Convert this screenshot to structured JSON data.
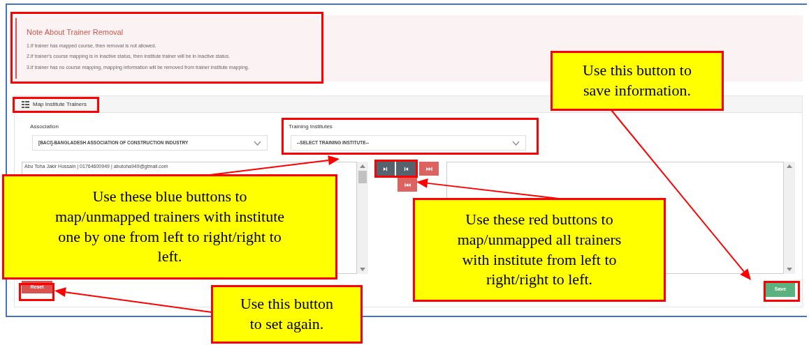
{
  "note": {
    "title": "Note About Trainer Removal",
    "lines": [
      "1.If trainer has mapped course, then removal is not allowed.",
      "2.If trainer's course mapping is in inactive status, then institute trainer will be in inactive status.",
      "3.If trainer has no course mapping, mapping information will be removed from trainer institute mapping."
    ]
  },
  "section": {
    "title": "Map Institute Trainers"
  },
  "fields": [
    {
      "label": "Association",
      "value": "[BACI]-BANGLADESH ASSOCIATION OF CONSTRUCTION INDUSTRY"
    },
    {
      "label": "Training Institutes",
      "value": "--SELECT TRAINING INSTITUTE--"
    }
  ],
  "left_list": [
    "Abu Toha Jakir Hossain | 01764600949 | abutoha949@gtmail.com"
  ],
  "transfer_buttons": [
    {
      "kind": "next"
    },
    {
      "kind": "previous"
    },
    {
      "kind": "last"
    },
    {
      "kind": "first"
    }
  ],
  "buttons": [
    {
      "kind": "reset",
      "label": "Reset"
    },
    {
      "kind": "save",
      "label": "Save"
    }
  ],
  "callouts": [
    {
      "text": "Use this button to save information."
    },
    {
      "text": "Use these blue buttons to map/unmapped trainers with institute one by one from left to right/right to left."
    },
    {
      "text": "Use these red buttons to map/unmapped all trainers with institute from left to right/right to left."
    },
    {
      "text": "Use this button to set again."
    }
  ]
}
